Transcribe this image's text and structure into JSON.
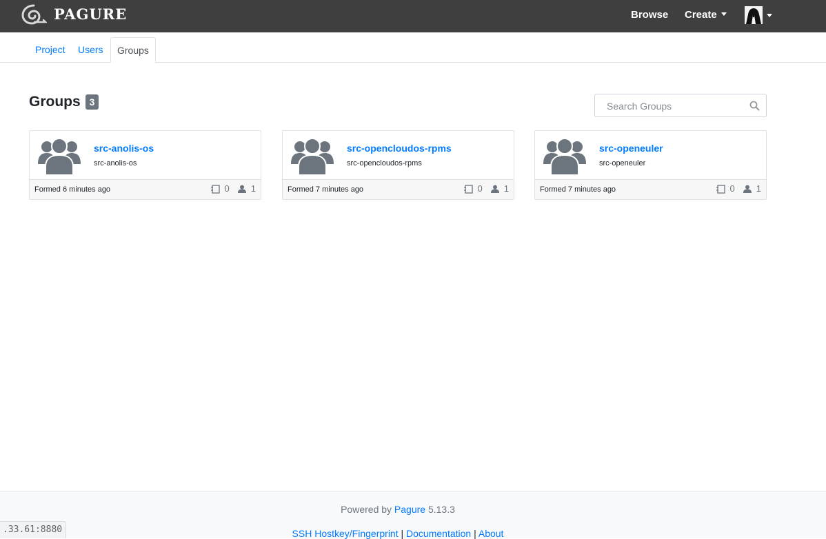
{
  "navbar": {
    "brand": "PAGURE",
    "browse": "Browse",
    "create": "Create"
  },
  "tabs": [
    "Project",
    "Users",
    "Groups"
  ],
  "active_tab": "Groups",
  "heading": {
    "title": "Groups",
    "count": "3"
  },
  "search": {
    "placeholder": "Search Groups"
  },
  "groups": [
    {
      "name": "src-anolis-os",
      "description": "src-anolis-os",
      "formed": "Formed 6 minutes ago",
      "projects": "0",
      "members": "1"
    },
    {
      "name": "src-opencloudos-rpms",
      "description": "src-opencloudos-rpms",
      "formed": "Formed 7 minutes ago",
      "projects": "0",
      "members": "1"
    },
    {
      "name": "src-openeuler",
      "description": "src-openeuler",
      "formed": "Formed 7 minutes ago",
      "projects": "0",
      "members": "1"
    }
  ],
  "footer": {
    "powered_prefix": "Powered by",
    "powered_link": "Pagure",
    "version": "5.13.3",
    "links": [
      "SSH Hostkey/Fingerprint",
      "Documentation",
      "About"
    ],
    "separator": "|"
  },
  "status_url": ".33.61:8880",
  "icons": {
    "brand": "pagure-spiral-logo-icon",
    "user": "user-avatar-icon",
    "search": "search-icon",
    "group_avatar": "users-group-icon",
    "projects": "calendar-icon",
    "members": "user-icon"
  },
  "colors": {
    "navbar": "#3f3f3f",
    "link": "#007bff",
    "badge": "#6c757d",
    "avatar_gray": "#6c757d"
  }
}
